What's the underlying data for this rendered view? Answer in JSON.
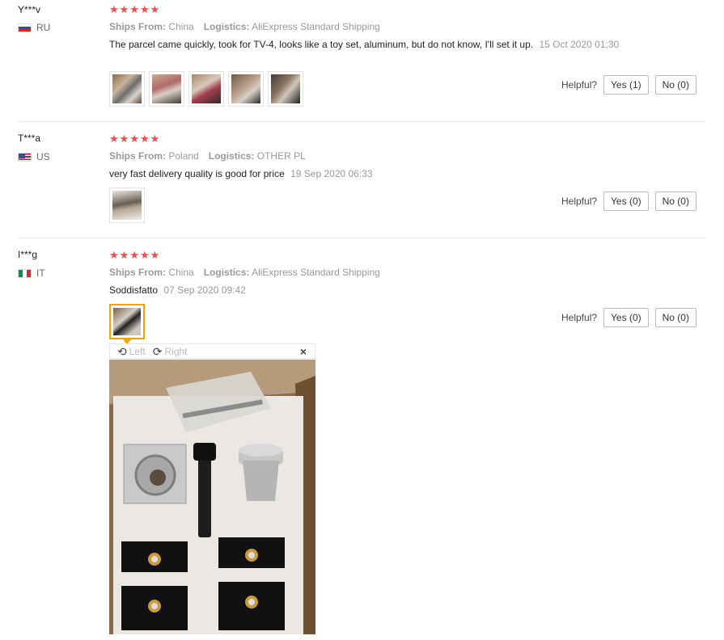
{
  "labels": {
    "ships_from": "Ships From:",
    "logistics": "Logistics:",
    "helpful": "Helpful?"
  },
  "reviews": [
    {
      "user": "Y***v",
      "country": "RU",
      "rating": 5,
      "ships_from": "China",
      "logistics": "AliExpress Standard Shipping",
      "comment": "The parcel came quickly, took for TV-4, looks like a toy set, aluminum, but do not know, I'll set it up.",
      "date": "15 Oct 2020 01:30",
      "photo_count": 5,
      "yes_label": "Yes (1)",
      "no_label": "No (0)"
    },
    {
      "user": "T***a",
      "country": "US",
      "rating": 5,
      "ships_from": "Poland",
      "logistics": "OTHER PL",
      "comment": "very fast delivery quality is good for price",
      "date": "19 Sep 2020 06:33",
      "photo_count": 1,
      "yes_label": "Yes (0)",
      "no_label": "No (0)"
    },
    {
      "user": "I***g",
      "country": "IT",
      "rating": 5,
      "ships_from": "China",
      "logistics": "AliExpress Standard Shipping",
      "comment": "Soddisfatto",
      "date": "07 Sep 2020 09:42",
      "photo_count": 1,
      "yes_label": "Yes (0)",
      "no_label": "No (0)"
    }
  ],
  "viewer": {
    "rotate_left": "Left",
    "rotate_right": "Right",
    "rotate_left_icon": "rotate-left-icon",
    "rotate_right_icon": "rotate-right-icon",
    "close_icon": "close-icon"
  },
  "colors": {
    "star": "#f44a4a",
    "active_thumb_border": "#f4a300"
  }
}
